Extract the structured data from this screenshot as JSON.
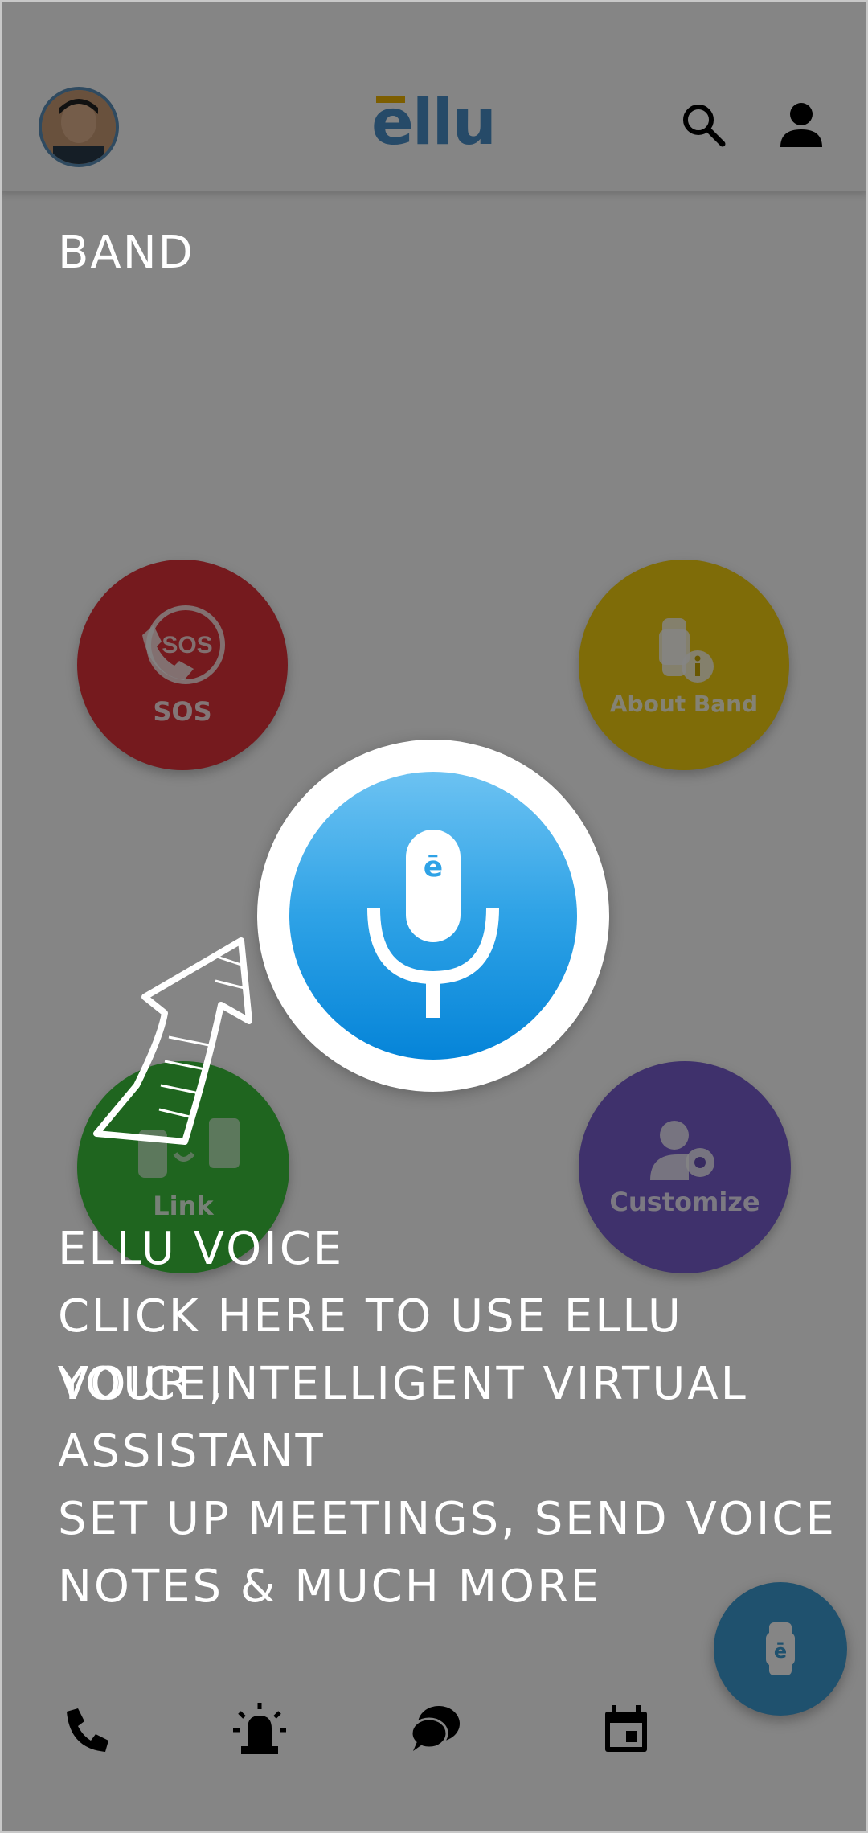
{
  "header": {
    "logo_text": "ellu",
    "avatar_label": "avatar",
    "search_icon": "search-icon",
    "profile_icon": "person-icon"
  },
  "tiles": {
    "sos": {
      "icon_text": "SOS",
      "label": "SOS",
      "color": "#e0333b"
    },
    "about_band": {
      "label": "About Band",
      "color": "#f4cf10"
    },
    "link": {
      "label": "Link",
      "color": "#3cc23c"
    },
    "customize": {
      "label": "Customize",
      "color": "#7a5fd0"
    }
  },
  "mic": {
    "badge": "ē",
    "color": "#0a85d9"
  },
  "bottom_nav": {
    "items": [
      "phone-icon",
      "alert-siren-icon",
      "chat-icon",
      "calendar-icon"
    ],
    "fab_badge": "ē"
  },
  "tutorial": {
    "section_label": "BAND",
    "title": "ELLU VOICE",
    "lines": [
      "CLICK HERE TO USE ELLU VOICE,",
      "YOUR INTELLIGENT VIRTUAL",
      "ASSISTANT",
      "SET UP MEETINGS, SEND VOICE",
      "NOTES & MUCH MORE"
    ]
  }
}
